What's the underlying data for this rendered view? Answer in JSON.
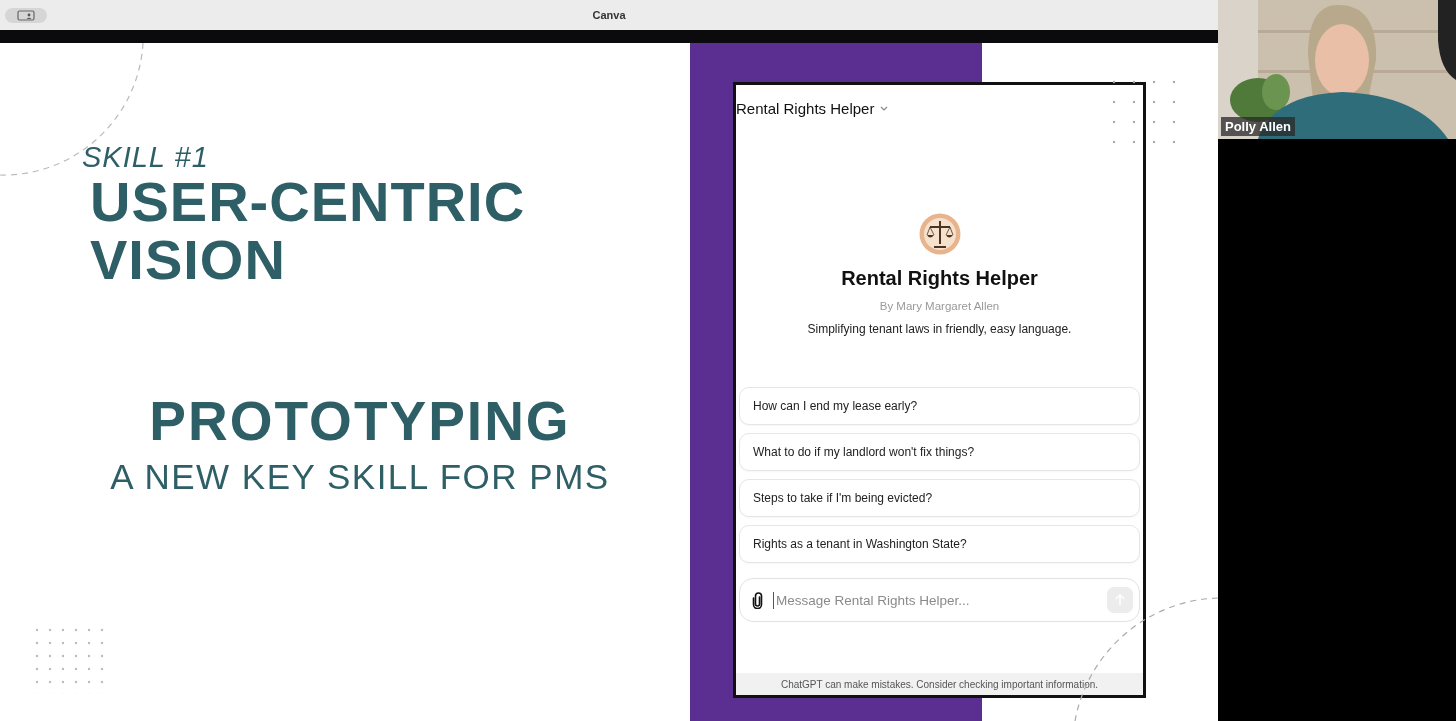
{
  "app_bar": {
    "title": "Canva"
  },
  "slide": {
    "skill_label": "SKILL #1",
    "headline_lines": [
      "USER-CENTRIC",
      "VISION"
    ],
    "topic": "PROTOTYPING",
    "subtitle": "A NEW KEY SKILL FOR PMS",
    "chat": {
      "header_title": "Rental Rights Helper",
      "name": "Rental Rights Helper",
      "author": "By Mary Margaret Allen",
      "description": "Simplifying tenant laws in friendly, easy language.",
      "suggestions": [
        "How can I end my lease early?",
        "What to do if my landlord won't fix things?",
        "Steps to take if I'm being evicted?",
        "Rights as a tenant in Washington State?"
      ],
      "composer": {
        "placeholder": "Message Rental Rights Helper..."
      },
      "send_button": {
        "disabled": true
      },
      "disclaimer": "ChatGPT can make mistakes. Consider checking important information."
    }
  },
  "video_tile": {
    "kind": "picture",
    "participant": "Polly Allen"
  }
}
